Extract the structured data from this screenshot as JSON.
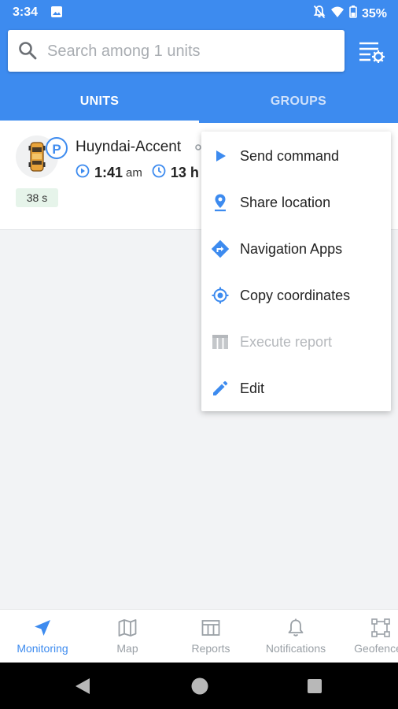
{
  "status_bar": {
    "time": "3:34",
    "battery": "35%",
    "icons": [
      "image-icon",
      "mute-icon",
      "wifi-icon",
      "battery-icon"
    ]
  },
  "search": {
    "placeholder": "Search among 1 units",
    "value": ""
  },
  "tabs": [
    {
      "label": "UNITS",
      "active": true
    },
    {
      "label": "GROUPS",
      "active": false
    }
  ],
  "unit": {
    "name": "Huyndai-Accent",
    "status_letter": "P",
    "last_message_time": "1:41",
    "last_message_ampm": "am",
    "duration": "13 h",
    "age": "38 s"
  },
  "context_menu": {
    "items": [
      {
        "label": "Send command",
        "icon": "play-icon",
        "enabled": true
      },
      {
        "label": "Share location",
        "icon": "location-pin-icon",
        "enabled": true
      },
      {
        "label": "Navigation Apps",
        "icon": "directions-icon",
        "enabled": true
      },
      {
        "label": "Copy coordinates",
        "icon": "crosshair-icon",
        "enabled": true
      },
      {
        "label": "Execute report",
        "icon": "table-icon",
        "enabled": false
      },
      {
        "label": "Edit",
        "icon": "pencil-icon",
        "enabled": true
      }
    ]
  },
  "bottom_nav": [
    {
      "label": "Monitoring",
      "icon": "navigation-arrow-icon",
      "active": true
    },
    {
      "label": "Map",
      "icon": "map-icon",
      "active": false
    },
    {
      "label": "Reports",
      "icon": "reports-icon",
      "active": false
    },
    {
      "label": "Notifications",
      "icon": "bell-icon",
      "active": false
    },
    {
      "label": "Geofences",
      "icon": "geofence-icon",
      "active": false
    }
  ],
  "colors": {
    "primary": "#3d8bef",
    "age_badge_bg": "#e6f4ea",
    "disabled_text": "#b5b8bc"
  }
}
